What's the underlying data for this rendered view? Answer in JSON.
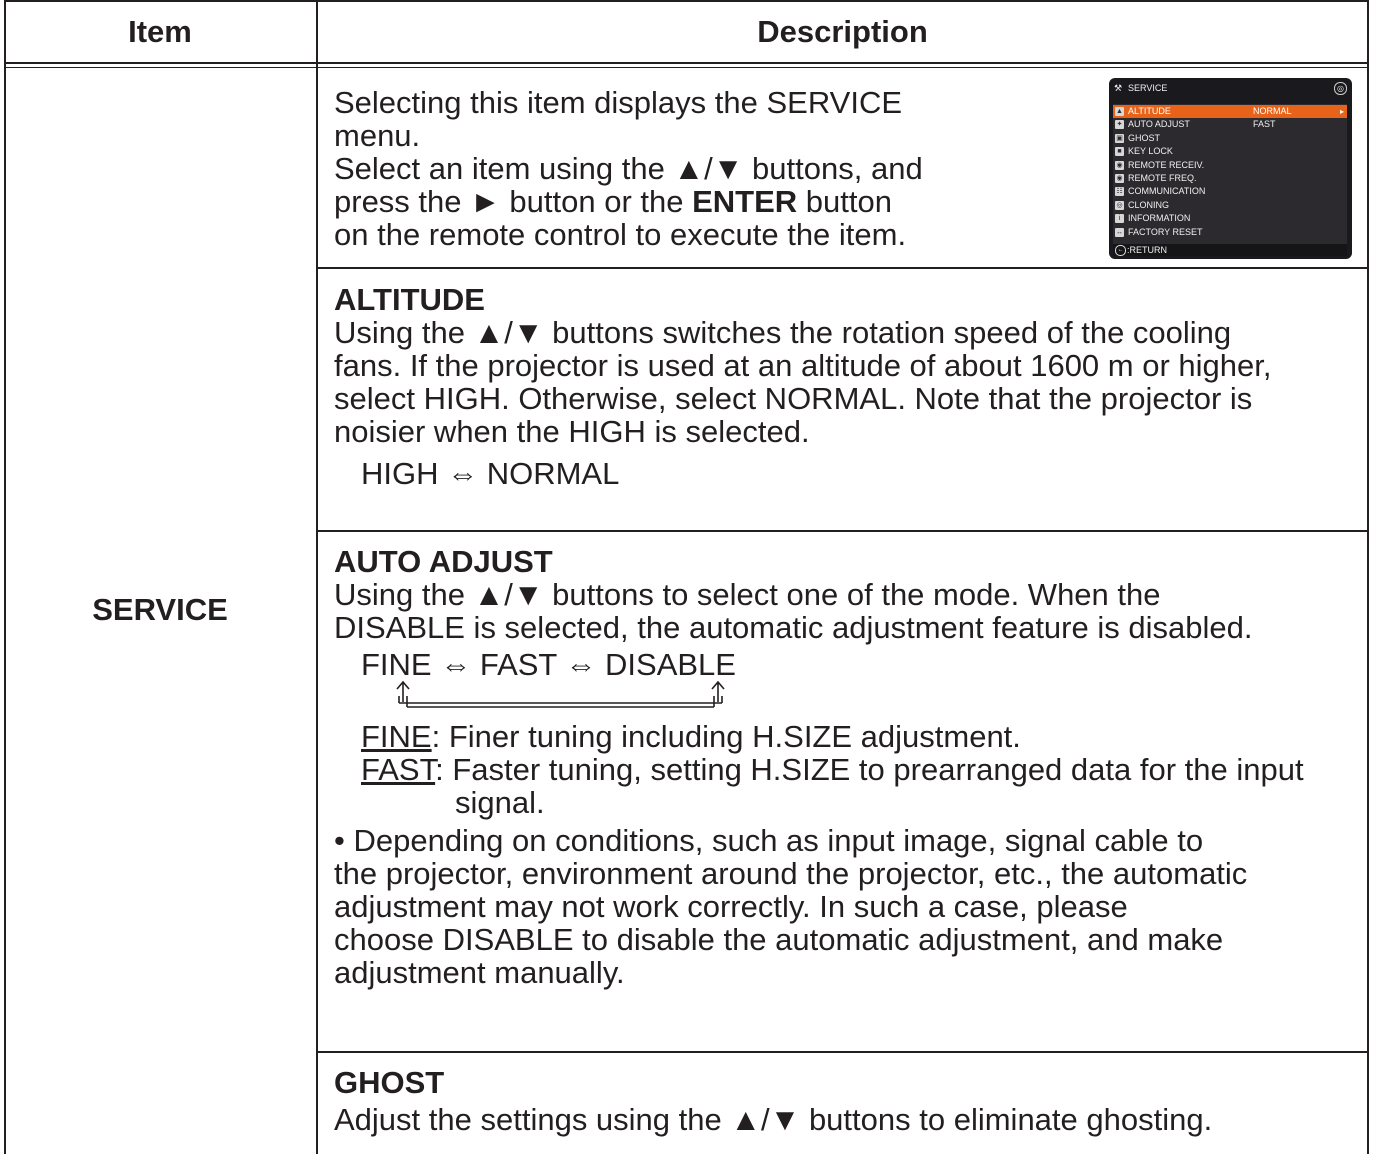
{
  "table": {
    "header_item": "Item",
    "header_description": "Description",
    "item_name": "SERVICE"
  },
  "intro": {
    "line1": "Selecting this item displays the SERVICE",
    "line2": "menu.",
    "line3": "Select an item using the ▲/▼ buttons, and",
    "line4_pre": "press the ► button or the ",
    "line4_bold": "ENTER",
    "line4_post": " button",
    "line5": "on the remote control to execute the item."
  },
  "osd_menu": {
    "title": "SERVICE",
    "items": [
      {
        "label": "ALTITUDE",
        "value": "NORMAL",
        "icon": "altitude-icon",
        "selected": true
      },
      {
        "label": "AUTO ADJUST",
        "value": "FAST",
        "icon": "auto-adjust-icon",
        "selected": false
      },
      {
        "label": "GHOST",
        "value": "",
        "icon": "ghost-icon",
        "selected": false
      },
      {
        "label": "KEY LOCK",
        "value": "",
        "icon": "lock-icon",
        "selected": false
      },
      {
        "label": "REMOTE RECEIV.",
        "value": "",
        "icon": "remote-icon",
        "selected": false
      },
      {
        "label": "REMOTE FREQ.",
        "value": "",
        "icon": "remote-icon",
        "selected": false
      },
      {
        "label": "COMMUNICATION",
        "value": "",
        "icon": "network-icon",
        "selected": false
      },
      {
        "label": "CLONING",
        "value": "",
        "icon": "cloning-icon",
        "selected": false
      },
      {
        "label": "INFORMATION",
        "value": "",
        "icon": "info-icon",
        "selected": false
      },
      {
        "label": "FACTORY RESET",
        "value": "",
        "icon": "reset-icon",
        "selected": false
      }
    ],
    "return_label": ":RETURN",
    "accent_color": "#e8631a"
  },
  "altitude": {
    "heading": "ALTITUDE",
    "line1": "Using the ▲/▼ buttons switches the rotation speed of the cooling",
    "line2": "fans. If the projector is used at an altitude of about 1600 m or higher,",
    "line3": "select HIGH. Otherwise, select NORMAL. Note that the projector is",
    "line4": "noisier when the HIGH is selected.",
    "options": "HIGH ⇔ NORMAL"
  },
  "auto_adjust": {
    "heading": "AUTO ADJUST",
    "line1": "Using the ▲/▼ buttons to select one of the mode. When the",
    "line2": "DISABLE is selected, the automatic adjustment feature is disabled.",
    "options": "FINE ⇔ FAST ⇔ DISABLE",
    "fine_term": "FINE",
    "fine_desc": ": Finer tuning including H.SIZE adjustment.",
    "fast_term": "FAST",
    "fast_desc": ": Faster tuning, setting H.SIZE to prearranged data for the input signal.",
    "note_line1": "• Depending on conditions, such as input image, signal cable to",
    "note_line2": "the projector, environment around the projector, etc., the automatic",
    "note_line3": "adjustment may not work correctly.  In such a case, please",
    "note_line4": "choose DISABLE to disable the automatic adjustment, and make",
    "note_line5": "adjustment manually."
  },
  "ghost": {
    "heading": "GHOST",
    "line1": "Adjust the settings using the ▲/▼ buttons to eliminate ghosting."
  }
}
